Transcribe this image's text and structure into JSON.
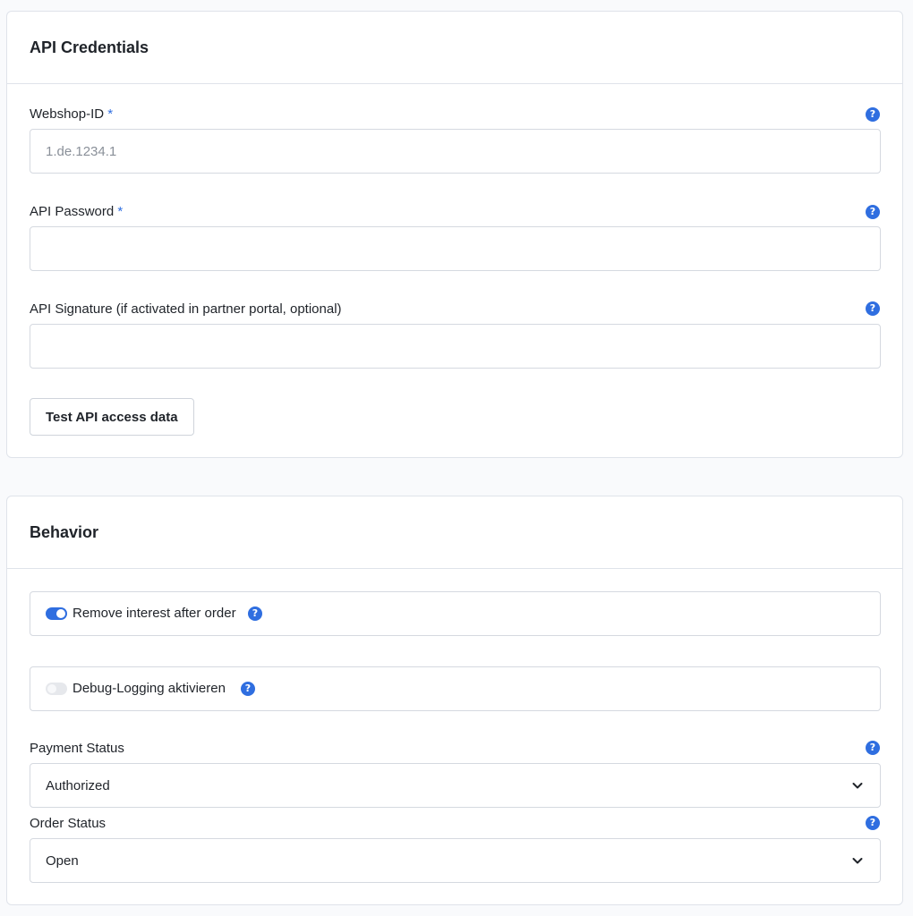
{
  "api_credentials": {
    "title": "API Credentials",
    "webshop_id": {
      "label": "Webshop-ID",
      "required_mark": "*",
      "placeholder": "1.de.1234.1",
      "value": ""
    },
    "api_password": {
      "label": "API Password",
      "required_mark": "*",
      "value": ""
    },
    "api_signature": {
      "label": "API Signature (if activated in partner portal, optional)",
      "value": ""
    },
    "test_button_label": "Test API access data"
  },
  "behavior": {
    "title": "Behavior",
    "remove_interest": {
      "label": "Remove interest after order",
      "enabled": true
    },
    "debug_logging": {
      "label": "Debug-Logging aktivieren",
      "enabled": false
    },
    "payment_status": {
      "label": "Payment Status",
      "selected": "Authorized"
    },
    "order_status": {
      "label": "Order Status",
      "selected": "Open"
    }
  },
  "icons": {
    "help": "?",
    "chevron": "chevron-down-icon"
  },
  "colors": {
    "accent": "#2f6ee0",
    "border": "#dfe3ea",
    "text": "#1f2329",
    "placeholder": "#8a9099"
  }
}
